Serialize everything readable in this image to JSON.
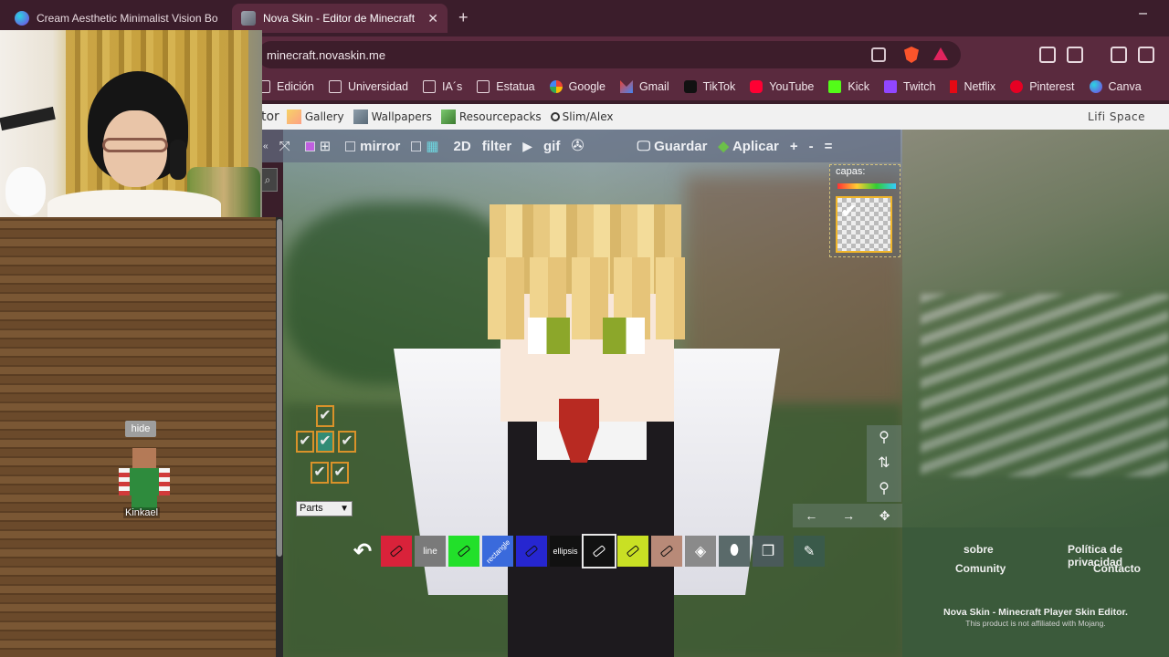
{
  "browser": {
    "tabs": [
      {
        "title": "Cream Aesthetic Minimalist Vision Bo",
        "icon": "canva-icon",
        "active": false
      },
      {
        "title": "Nova Skin - Editor de Minecraft",
        "icon": "novaskin-icon",
        "active": true,
        "close": "✕"
      }
    ],
    "new_tab": "+",
    "minimize": "–",
    "url": "minecraft.novaskin.me",
    "bookmarks": [
      {
        "label": "Edición",
        "icon": "folder"
      },
      {
        "label": "Universidad",
        "icon": "folder"
      },
      {
        "label": "IA´s",
        "icon": "ia"
      },
      {
        "label": "Estatua",
        "icon": "folder"
      },
      {
        "label": "Google",
        "icon": "google"
      },
      {
        "label": "Gmail",
        "icon": "gmail"
      },
      {
        "label": "TikTok",
        "icon": "tiktok"
      },
      {
        "label": "YouTube",
        "icon": "yt"
      },
      {
        "label": "Kick",
        "icon": "kick"
      },
      {
        "label": "Twitch",
        "icon": "twitch"
      },
      {
        "label": "Netflix",
        "icon": "netflix"
      },
      {
        "label": "Pinterest",
        "icon": "pin"
      },
      {
        "label": "Canva",
        "icon": "canva"
      }
    ]
  },
  "site_nav": {
    "fragment": "tor",
    "items": [
      {
        "label": "Gallery",
        "icon": "gal"
      },
      {
        "label": "Wallpapers",
        "icon": "wall"
      },
      {
        "label": "Resourcepacks",
        "icon": "res"
      },
      {
        "label": "Slim/Alex",
        "icon": "slim"
      }
    ],
    "right": "Lifi Space"
  },
  "toolbar": {
    "mirror": "mirror",
    "mode_2d": "2D",
    "filter": "filter",
    "gif": "gif",
    "save": "Guardar",
    "apply": "Aplicar",
    "plus": "+",
    "minus": "-",
    "menu": "="
  },
  "layers": {
    "label": "capas:"
  },
  "left_panel": {
    "hide": "hide",
    "skin_name": "Kinkael",
    "search_glyph": "⌕"
  },
  "parts": {
    "select": "Parts"
  },
  "tools": [
    {
      "name": "undo",
      "label": "",
      "color": "transparent"
    },
    {
      "name": "pencil-red",
      "label": "",
      "color": "#d9223a"
    },
    {
      "name": "line",
      "label": "line",
      "color": "#7a7a7a"
    },
    {
      "name": "pencil-green",
      "label": "",
      "color": "#22e02a"
    },
    {
      "name": "rectangle",
      "label": "rectangle",
      "color": "#3a6adc"
    },
    {
      "name": "pencil-blue",
      "label": "",
      "color": "#2626d0"
    },
    {
      "name": "ellipsis",
      "label": "ellipsis",
      "color": "#111111"
    },
    {
      "name": "pencil-black",
      "label": "",
      "color": "#111111"
    },
    {
      "name": "pencil-lime",
      "label": "",
      "color": "#c9e024"
    },
    {
      "name": "pencil-brown",
      "label": "",
      "color": "#b88a78"
    },
    {
      "name": "bucket",
      "label": "",
      "color": "#8a8a8a"
    },
    {
      "name": "eraser",
      "label": "",
      "color": "#5a6a6a"
    },
    {
      "name": "layers-tool",
      "label": "",
      "color": "#4a5a5a"
    },
    {
      "name": "eyedropper",
      "label": "",
      "color": "#3a5a4a"
    }
  ],
  "footer": {
    "about": "sobre",
    "community": "Comunity",
    "privacy": "Política de privacidad",
    "contact": "Contacto",
    "credit": "Nova Skin - Minecraft Player Skin Editor.",
    "disclaimer": "This product is not affiliated with Mojang."
  }
}
